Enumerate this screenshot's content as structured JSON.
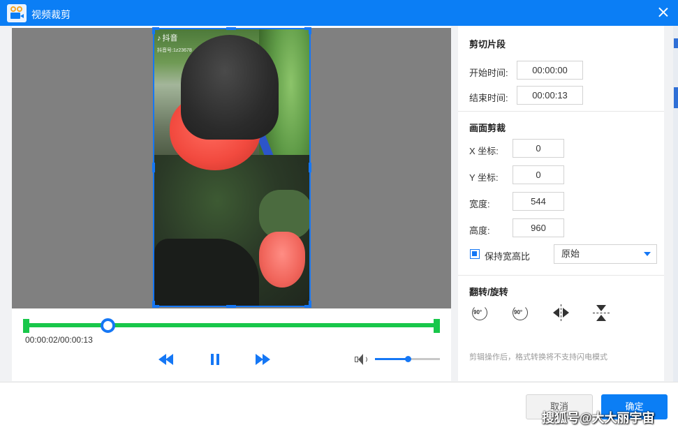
{
  "window": {
    "title": "视频裁剪"
  },
  "video": {
    "overlay_logo": "抖音",
    "overlay_handle": "抖音号:1z23678"
  },
  "playback": {
    "time_display": "00:00:02/00:00:13",
    "progress_fraction": 0.2,
    "volume_fraction": 0.5
  },
  "clip": {
    "title": "剪切片段",
    "start_label": "开始时间:",
    "start_value": "00:00:00",
    "end_label": "结束时间:",
    "end_value": "00:00:13"
  },
  "crop": {
    "title": "画面剪裁",
    "x_label": "X 坐标:",
    "x_value": "0",
    "y_label": "Y 坐标:",
    "y_value": "0",
    "width_label": "宽度:",
    "width_value": "544",
    "height_label": "高度:",
    "height_value": "960",
    "keep_ratio_label": "保持宽高比",
    "keep_ratio_checked": true,
    "ratio_selected": "原始"
  },
  "transform": {
    "title": "翻转/旋转",
    "rotate_left_label": "90°",
    "rotate_right_label": "90°",
    "note": "剪辑操作后，格式转换将不支持闪电模式"
  },
  "footer": {
    "cancel_label": "取消",
    "ok_label": "确定"
  },
  "watermark": "搜狐号@大大丽宇宙",
  "colors": {
    "accent": "#0b7ef5",
    "progress": "#18c74a",
    "selection": "#1577f5"
  }
}
